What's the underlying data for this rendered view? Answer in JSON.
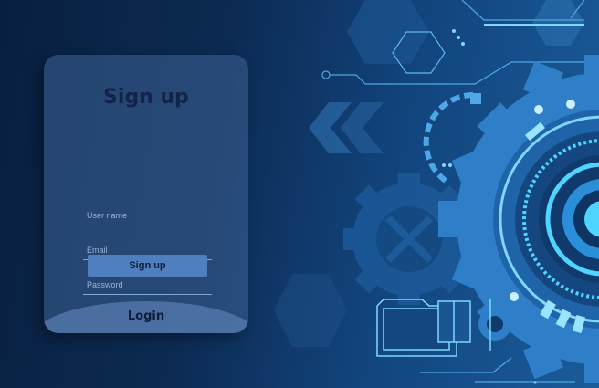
{
  "signup_form": {
    "title": "Sign up",
    "username_placeholder": "User name",
    "email_placeholder": "Email",
    "password_placeholder": "Password",
    "submit_label": "Sign up",
    "login_label": "Login"
  },
  "colors": {
    "background": "#0c2a52",
    "card": "#3e6296",
    "button": "#4f7fbf",
    "accent": "#4fd4ff"
  },
  "icons": [
    "gear-illustration",
    "hexagon-shape",
    "chevron-arrows",
    "folder-icon",
    "circuit-lines"
  ]
}
